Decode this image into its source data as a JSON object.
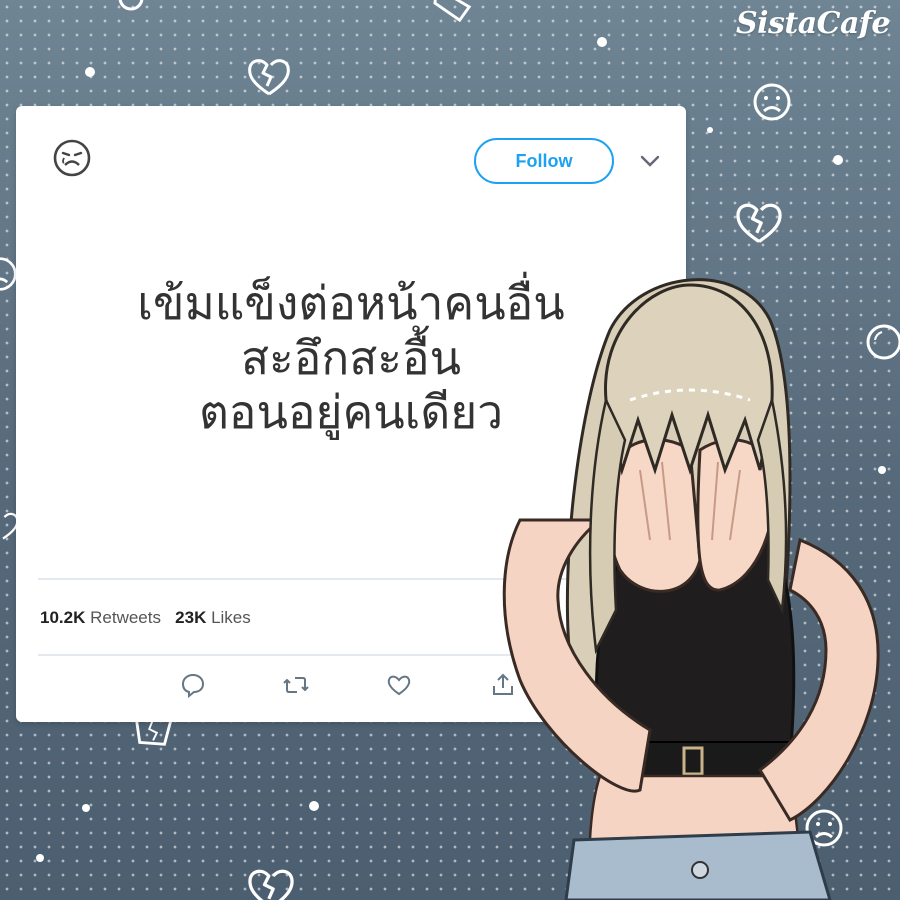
{
  "brand": {
    "logo_text": "SistaCafe"
  },
  "tweet_card": {
    "follow_label": "Follow",
    "text_lines": [
      "เข้มแข็งต่อหน้าคนอื่น",
      "สะอึกสะอื้น",
      "ตอนอยู่คนเดียว"
    ],
    "retweets_count": "10.2K",
    "retweets_label": "Retweets",
    "likes_count": "23K",
    "likes_label": "Likes",
    "actions": [
      "reply-icon",
      "retweet-icon",
      "like-icon",
      "share-icon"
    ]
  },
  "colors": {
    "background": "#5d7282",
    "accent": "#1da1f2",
    "card": "#ffffff",
    "text": "#333333"
  }
}
